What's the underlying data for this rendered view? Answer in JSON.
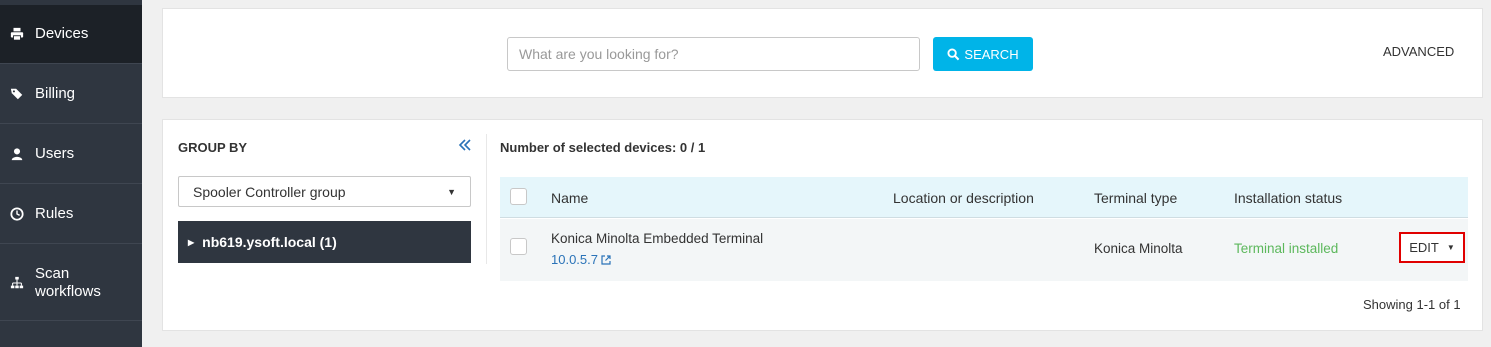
{
  "sidebar": {
    "items": [
      {
        "label": "Devices",
        "icon": "printer-icon",
        "active": true
      },
      {
        "label": "Billing",
        "icon": "tags-icon",
        "active": false
      },
      {
        "label": "Users",
        "icon": "user-icon",
        "active": false
      },
      {
        "label": "Rules",
        "icon": "clock-icon",
        "active": false
      },
      {
        "label": "Scan workflows",
        "icon": "sitemap-icon",
        "active": false
      }
    ]
  },
  "search": {
    "placeholder": "What are you looking for?",
    "value": "",
    "button_label": "SEARCH",
    "advanced_label": "ADVANCED"
  },
  "group_panel": {
    "title": "GROUP BY",
    "select_value": "Spooler Controller group",
    "tree_item": "nb619.ysoft.local (1)"
  },
  "devices": {
    "selected_text": "Number of selected devices: 0 / 1",
    "columns": [
      "Name",
      "Location or description",
      "Terminal type",
      "Installation status"
    ],
    "rows": [
      {
        "name": "Konica Minolta Embedded Terminal",
        "ip": "10.0.5.7",
        "location": "",
        "terminal_type": "Konica Minolta",
        "status": "Terminal installed",
        "action": "EDIT"
      }
    ],
    "showing": "Showing 1-1 of 1"
  },
  "colors": {
    "sidebar_bg": "#2f3640",
    "accent": "#00b4e8",
    "status_ok": "#5cb85c",
    "link": "#2a73b8",
    "highlight": "#e00000"
  }
}
